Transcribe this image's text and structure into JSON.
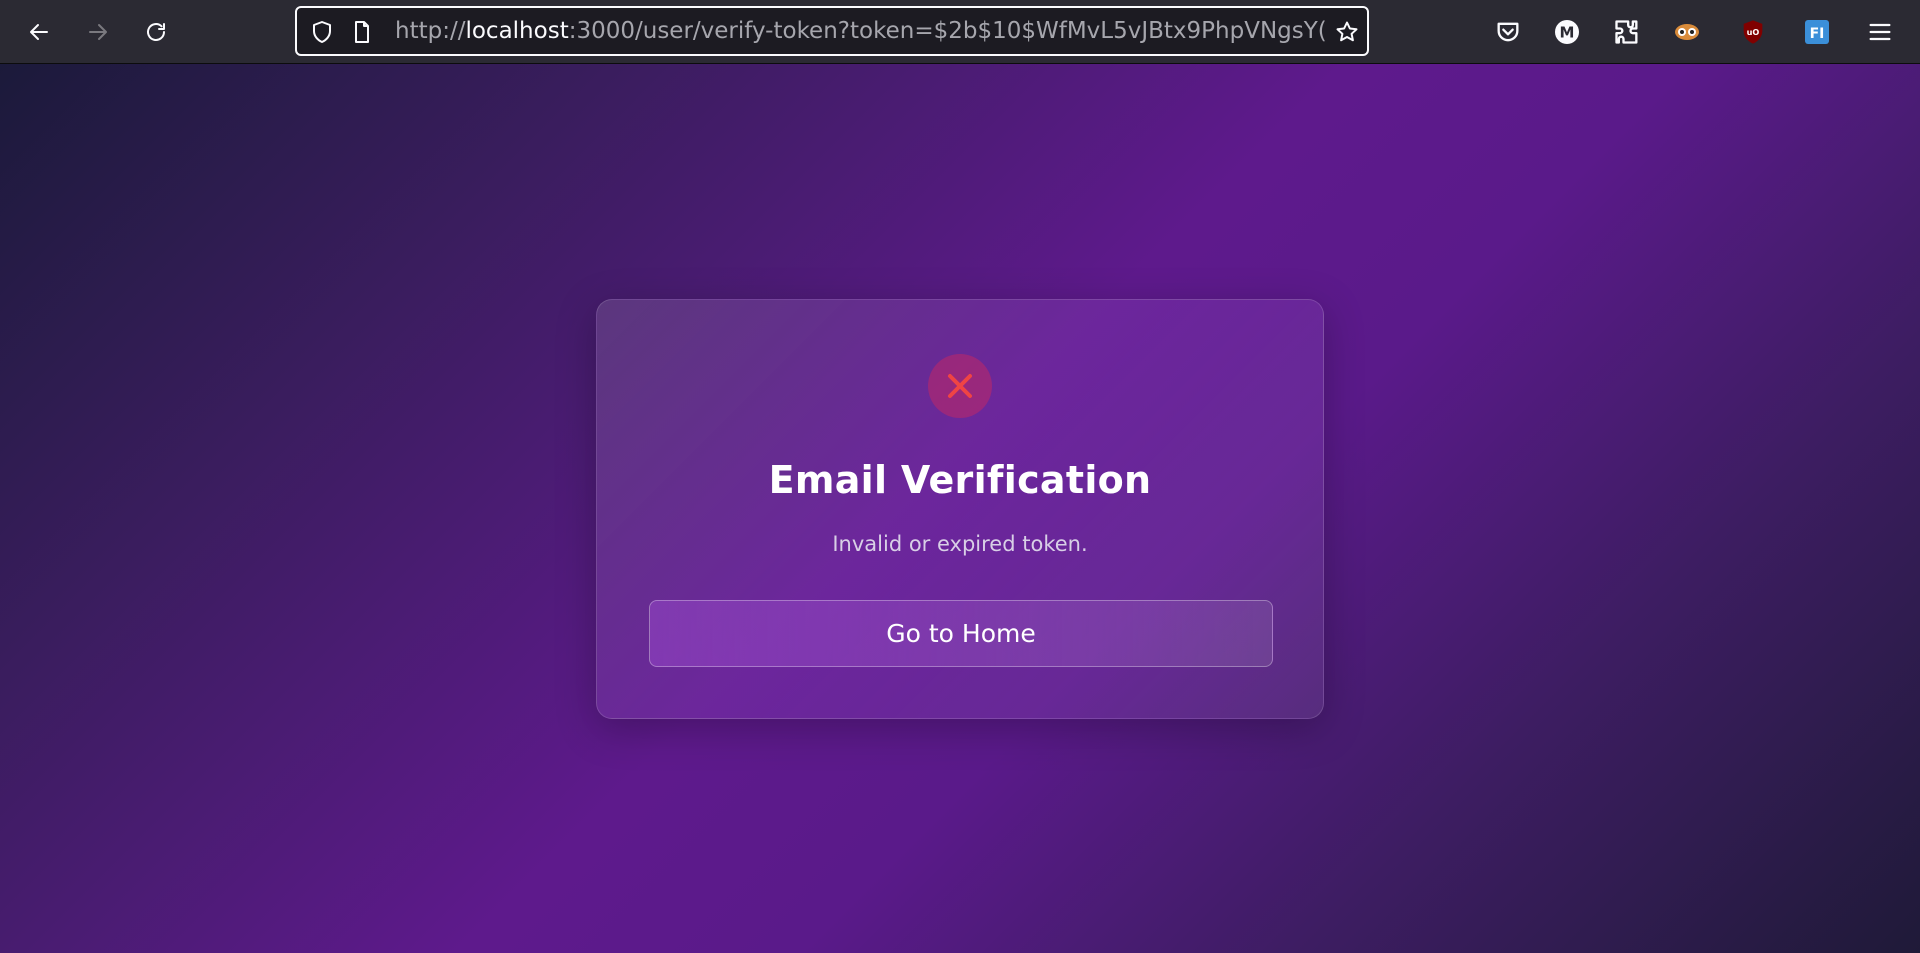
{
  "browser": {
    "url_scheme": "http://",
    "url_host": "localhost",
    "url_rest": ":3000/user/verify-token?token=$2b$10$WfMvL5vJBtx9PhpVNgsY(",
    "nav": {
      "back_icon": "arrow-left-icon",
      "forward_icon": "arrow-right-icon",
      "reload_icon": "reload-icon"
    },
    "extensions": [
      "pocket-icon",
      "m-account-icon",
      "extensions-icon",
      "eyes-extension-icon",
      "ublock-icon",
      "fi-extension-icon",
      "menu-icon"
    ]
  },
  "page": {
    "status_icon": "close-x-icon",
    "title": "Email Verification",
    "message": "Invalid or expired token.",
    "home_button_label": "Go to Home"
  },
  "colors": {
    "error_red": "#ef4444",
    "card_text": "#ffffff",
    "accent_purple": "#5e1a8c"
  }
}
